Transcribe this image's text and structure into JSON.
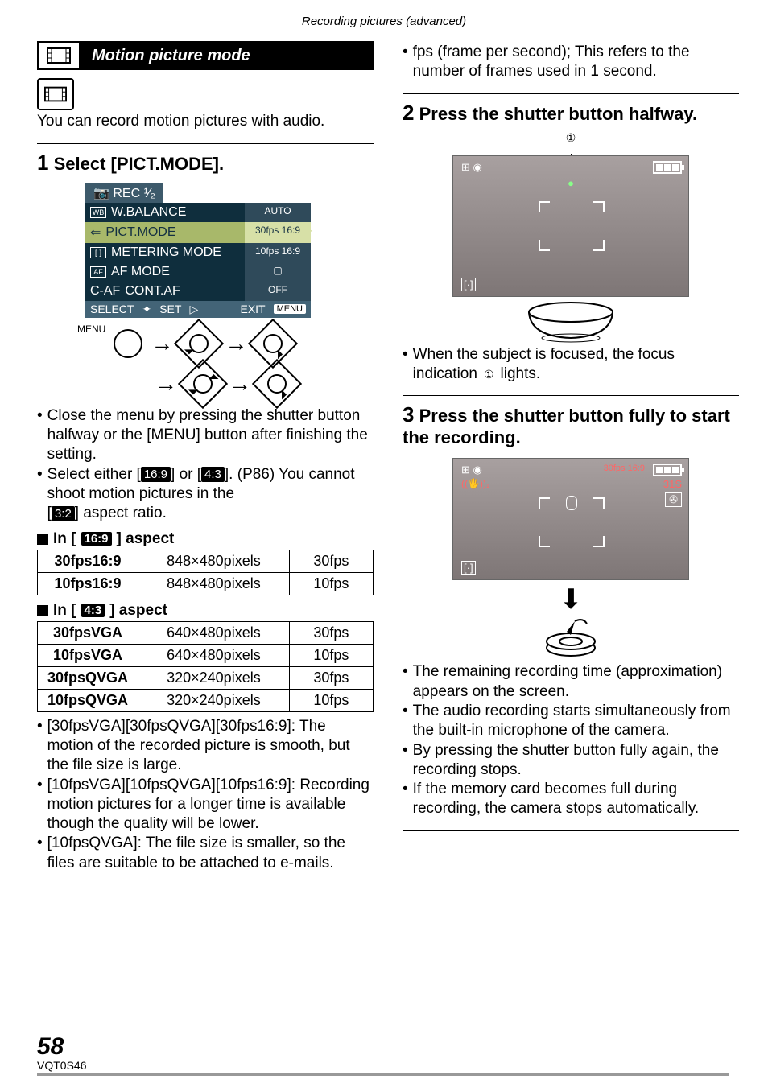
{
  "header": {
    "breadcrumb": "Recording pictures (advanced)"
  },
  "section_title": "Motion picture mode",
  "intro": "You can record motion pictures with audio.",
  "step1": {
    "number": "1",
    "title": "Select [PICT.MODE].",
    "menu": {
      "tab": "REC  ¹⁄₂",
      "rows": [
        {
          "icon": "WB",
          "label": "W.BALANCE",
          "value": "AUTO"
        },
        {
          "icon": "⇐",
          "label": "PICT.MODE",
          "value": "30fps 16:9"
        },
        {
          "icon": "[·]",
          "label": "METERING MODE",
          "value": "10fps 16:9"
        },
        {
          "icon": "AF",
          "label": "AF MODE",
          "value": "▢"
        },
        {
          "icon": "C-AF",
          "label": "CONT.AF",
          "value": "OFF"
        }
      ],
      "footer": {
        "select": "SELECT",
        "set": "SET",
        "exit": "EXIT",
        "menu_badge": "MENU"
      }
    },
    "nav_label": "MENU",
    "note_close": "Close the menu by pressing the shutter button halfway or the [MENU] button after finishing the setting.",
    "note_select_a": "Select either [",
    "note_select_b": "] or [",
    "note_select_c": "]. (P86) You cannot shoot motion pictures in the",
    "note_select_d": "[",
    "note_select_e": "] aspect ratio.",
    "badge_169": "16:9",
    "badge_43": "4:3",
    "badge_32": "3:2"
  },
  "aspect169": {
    "heading_a": "In [",
    "heading_b": "] aspect",
    "badge": "16:9",
    "rows": [
      {
        "mode": "30fps16:9",
        "res": "848×480pixels",
        "fps": "30fps"
      },
      {
        "mode": "10fps16:9",
        "res": "848×480pixels",
        "fps": "10fps"
      }
    ]
  },
  "aspect43": {
    "heading_a": "In [",
    "heading_b": "] aspect",
    "badge": "4:3",
    "rows": [
      {
        "mode": "30fpsVGA",
        "res": "640×480pixels",
        "fps": "30fps"
      },
      {
        "mode": "10fpsVGA",
        "res": "640×480pixels",
        "fps": "10fps"
      },
      {
        "mode": "30fpsQVGA",
        "res": "320×240pixels",
        "fps": "30fps"
      },
      {
        "mode": "10fpsQVGA",
        "res": "320×240pixels",
        "fps": "10fps"
      }
    ]
  },
  "bullets_left": [
    "[30fpsVGA][30fpsQVGA][30fps16:9]: The motion of the recorded picture is smooth, but the file size is large.",
    "[10fpsVGA][10fpsQVGA][10fps16:9]: Recording motion pictures for a longer time is available though the quality will be lower.",
    "[10fpsQVGA]: The file size is smaller, so the files are suitable to be attached to e-mails."
  ],
  "right_top_bullet": "fps (frame per second); This refers to the number of frames used in 1 second.",
  "step2": {
    "number": "2",
    "title": "Press the shutter button halfway.",
    "callout": "①",
    "note_a": "When the subject is focused, the focus indication ",
    "note_b": " lights."
  },
  "step3": {
    "number": "3",
    "title": "Press the shutter button fully to start the recording.",
    "osd": {
      "fps": "30fps 16:9",
      "time": "31S",
      "stab": "((🖐))₁"
    }
  },
  "bullets_right": [
    "The remaining recording time (approximation) appears on the screen.",
    "The audio recording starts simultaneously from the built-in microphone of the camera.",
    "By pressing the shutter button fully again, the recording stops.",
    "If the memory card becomes full during recording, the camera stops automatically."
  ],
  "footer": {
    "page": "58",
    "code": "VQT0S46"
  }
}
